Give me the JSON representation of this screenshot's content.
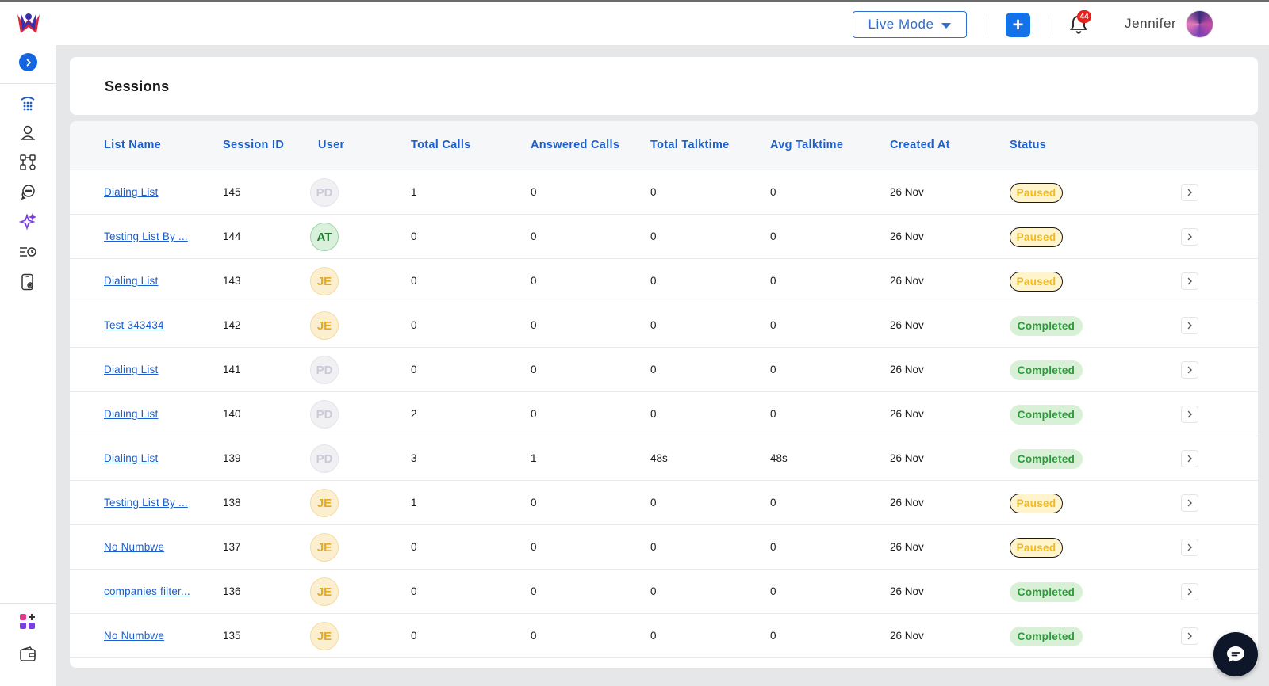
{
  "topbar": {
    "mode_label": "Live Mode",
    "add_label": "+",
    "notification_count": "44",
    "user_name": "Jennifer"
  },
  "icons": {
    "logo": "brand-logo",
    "expand": "chevron-right-icon",
    "nav": [
      "dialpad-icon",
      "contacts-icon",
      "workflow-icon",
      "chat-bubbles-icon",
      "ai-sparkle-icon",
      "history-icon",
      "phone-settings-icon"
    ],
    "bottom": [
      "add-app-icon",
      "wallet-icon"
    ]
  },
  "page": {
    "title": "Sessions"
  },
  "table": {
    "headers": [
      "List Name",
      "Session ID",
      "User",
      "Total Calls",
      "Answered Calls",
      "Total Talktime",
      "Avg Talktime",
      "Created At",
      "Status"
    ],
    "rows": [
      {
        "list_name": "Dialing List",
        "session_id": "145",
        "user": "PD",
        "total_calls": "1",
        "answered_calls": "0",
        "total_talktime": "0",
        "avg_talktime": "0",
        "created_at": "26 Nov",
        "status": "Paused"
      },
      {
        "list_name": "Testing List By ...",
        "session_id": "144",
        "user": "AT",
        "total_calls": "0",
        "answered_calls": "0",
        "total_talktime": "0",
        "avg_talktime": "0",
        "created_at": "26 Nov",
        "status": "Paused"
      },
      {
        "list_name": "Dialing List",
        "session_id": "143",
        "user": "JE",
        "total_calls": "0",
        "answered_calls": "0",
        "total_talktime": "0",
        "avg_talktime": "0",
        "created_at": "26 Nov",
        "status": "Paused"
      },
      {
        "list_name": "Test 343434",
        "session_id": "142",
        "user": "JE",
        "total_calls": "0",
        "answered_calls": "0",
        "total_talktime": "0",
        "avg_talktime": "0",
        "created_at": "26 Nov",
        "status": "Completed"
      },
      {
        "list_name": "Dialing List",
        "session_id": "141",
        "user": "PD",
        "total_calls": "0",
        "answered_calls": "0",
        "total_talktime": "0",
        "avg_talktime": "0",
        "created_at": "26 Nov",
        "status": "Completed"
      },
      {
        "list_name": "Dialing List",
        "session_id": "140",
        "user": "PD",
        "total_calls": "2",
        "answered_calls": "0",
        "total_talktime": "0",
        "avg_talktime": "0",
        "created_at": "26 Nov",
        "status": "Completed"
      },
      {
        "list_name": "Dialing List",
        "session_id": "139",
        "user": "PD",
        "total_calls": "3",
        "answered_calls": "1",
        "total_talktime": "48s",
        "avg_talktime": "48s",
        "created_at": "26 Nov",
        "status": "Completed"
      },
      {
        "list_name": "Testing List By ...",
        "session_id": "138",
        "user": "JE",
        "total_calls": "1",
        "answered_calls": "0",
        "total_talktime": "0",
        "avg_talktime": "0",
        "created_at": "26 Nov",
        "status": "Paused"
      },
      {
        "list_name": "No Numbwe",
        "session_id": "137",
        "user": "JE",
        "total_calls": "0",
        "answered_calls": "0",
        "total_talktime": "0",
        "avg_talktime": "0",
        "created_at": "26 Nov",
        "status": "Paused"
      },
      {
        "list_name": "companies filter...",
        "session_id": "136",
        "user": "JE",
        "total_calls": "0",
        "answered_calls": "0",
        "total_talktime": "0",
        "avg_talktime": "0",
        "created_at": "26 Nov",
        "status": "Completed"
      },
      {
        "list_name": "No Numbwe",
        "session_id": "135",
        "user": "JE",
        "total_calls": "0",
        "answered_calls": "0",
        "total_talktime": "0",
        "avg_talktime": "0",
        "created_at": "26 Nov",
        "status": "Completed"
      }
    ]
  },
  "colors": {
    "accent": "#1f5fc9",
    "primary_button": "#1472e8",
    "badge": "#e5221c",
    "paused_text": "#f2b91a",
    "completed_text": "#2d9b3a"
  }
}
